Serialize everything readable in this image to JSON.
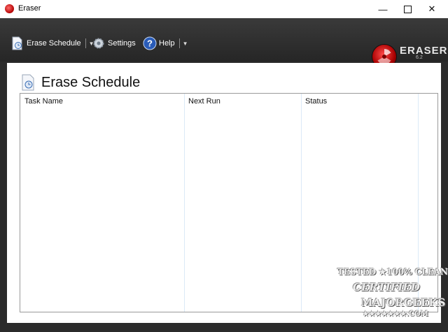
{
  "window": {
    "title": "Eraser"
  },
  "toolbar": {
    "erase_schedule_label": "Erase Schedule",
    "settings_label": "Settings",
    "help_label": "Help"
  },
  "logo": {
    "name": "ERASER",
    "version": "6.2"
  },
  "panel": {
    "title": "Erase Schedule"
  },
  "list": {
    "columns": [
      "Task Name",
      "Next Run",
      "Status"
    ]
  },
  "watermark": {
    "line1": "TESTED ★100% CLEAN",
    "line2": "CERTIFIED",
    "line3": "MAJORGEEKS",
    "line4": "★★★★★★★.COM"
  },
  "colors": {
    "toolbar_bg": "#2b2b2b",
    "logo_red": "#c00000",
    "help_blue": "#2a5cb8"
  }
}
